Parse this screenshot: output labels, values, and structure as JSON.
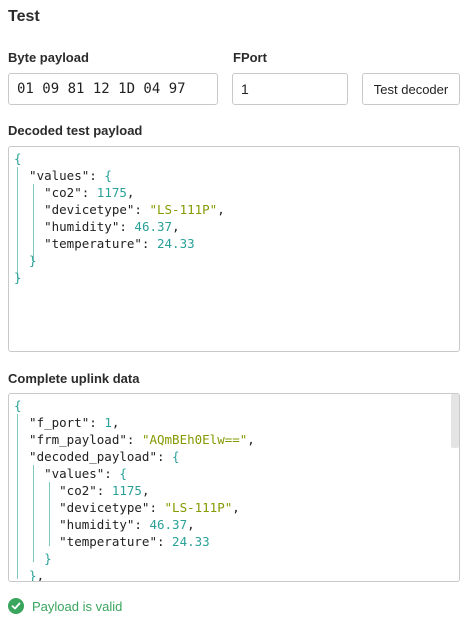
{
  "section_title": "Test",
  "byte_payload": {
    "label": "Byte payload",
    "value": "01 09 81 12 1D 04 97"
  },
  "fport": {
    "label": "FPort",
    "value": "1"
  },
  "test_button": {
    "label": "Test decoder"
  },
  "decoded": {
    "label": "Decoded test payload",
    "lines": [
      {
        "tokens": [
          {
            "t": "{",
            "c": "b"
          }
        ]
      },
      {
        "tokens": [
          {
            "t": "  \"values\": ",
            "c": "k"
          },
          {
            "t": "{",
            "c": "b"
          }
        ]
      },
      {
        "tokens": [
          {
            "t": "    \"co2\": ",
            "c": "k"
          },
          {
            "t": "1175",
            "c": "b"
          },
          {
            "t": ",",
            "c": "p"
          }
        ]
      },
      {
        "tokens": [
          {
            "t": "    \"devicetype\": ",
            "c": "k"
          },
          {
            "t": "\"LS-111P\"",
            "c": "s"
          },
          {
            "t": ",",
            "c": "p"
          }
        ]
      },
      {
        "tokens": [
          {
            "t": "    \"humidity\": ",
            "c": "k"
          },
          {
            "t": "46.37",
            "c": "b"
          },
          {
            "t": ",",
            "c": "p"
          }
        ]
      },
      {
        "tokens": [
          {
            "t": "    \"temperature\": ",
            "c": "k"
          },
          {
            "t": "24.33",
            "c": "b"
          }
        ]
      },
      {
        "tokens": [
          {
            "t": "  }",
            "c": "b"
          }
        ]
      },
      {
        "tokens": [
          {
            "t": "}",
            "c": "b"
          }
        ]
      }
    ]
  },
  "uplink": {
    "label": "Complete uplink data",
    "lines": [
      {
        "tokens": [
          {
            "t": "{",
            "c": "b"
          }
        ]
      },
      {
        "tokens": [
          {
            "t": "  \"f_port\": ",
            "c": "k"
          },
          {
            "t": "1",
            "c": "b"
          },
          {
            "t": ",",
            "c": "p"
          }
        ]
      },
      {
        "tokens": [
          {
            "t": "  \"frm_payload\": ",
            "c": "k"
          },
          {
            "t": "\"AQmBEh0Elw==\"",
            "c": "s"
          },
          {
            "t": ",",
            "c": "p"
          }
        ]
      },
      {
        "tokens": [
          {
            "t": "  \"decoded_payload\": ",
            "c": "k"
          },
          {
            "t": "{",
            "c": "b"
          }
        ]
      },
      {
        "tokens": [
          {
            "t": "    \"values\": ",
            "c": "k"
          },
          {
            "t": "{",
            "c": "b"
          }
        ]
      },
      {
        "tokens": [
          {
            "t": "      \"co2\": ",
            "c": "k"
          },
          {
            "t": "1175",
            "c": "b"
          },
          {
            "t": ",",
            "c": "p"
          }
        ]
      },
      {
        "tokens": [
          {
            "t": "      \"devicetype\": ",
            "c": "k"
          },
          {
            "t": "\"LS-111P\"",
            "c": "s"
          },
          {
            "t": ",",
            "c": "p"
          }
        ]
      },
      {
        "tokens": [
          {
            "t": "      \"humidity\": ",
            "c": "k"
          },
          {
            "t": "46.37",
            "c": "b"
          },
          {
            "t": ",",
            "c": "p"
          }
        ]
      },
      {
        "tokens": [
          {
            "t": "      \"temperature\": ",
            "c": "k"
          },
          {
            "t": "24.33",
            "c": "b"
          }
        ]
      },
      {
        "tokens": [
          {
            "t": "    }",
            "c": "b"
          }
        ]
      },
      {
        "tokens": [
          {
            "t": "  }",
            "c": "b"
          },
          {
            "t": ",",
            "c": "p"
          }
        ]
      }
    ]
  },
  "status": {
    "text": "Payload is valid",
    "icon": "check-circle-icon",
    "color": "#3aa55d"
  }
}
